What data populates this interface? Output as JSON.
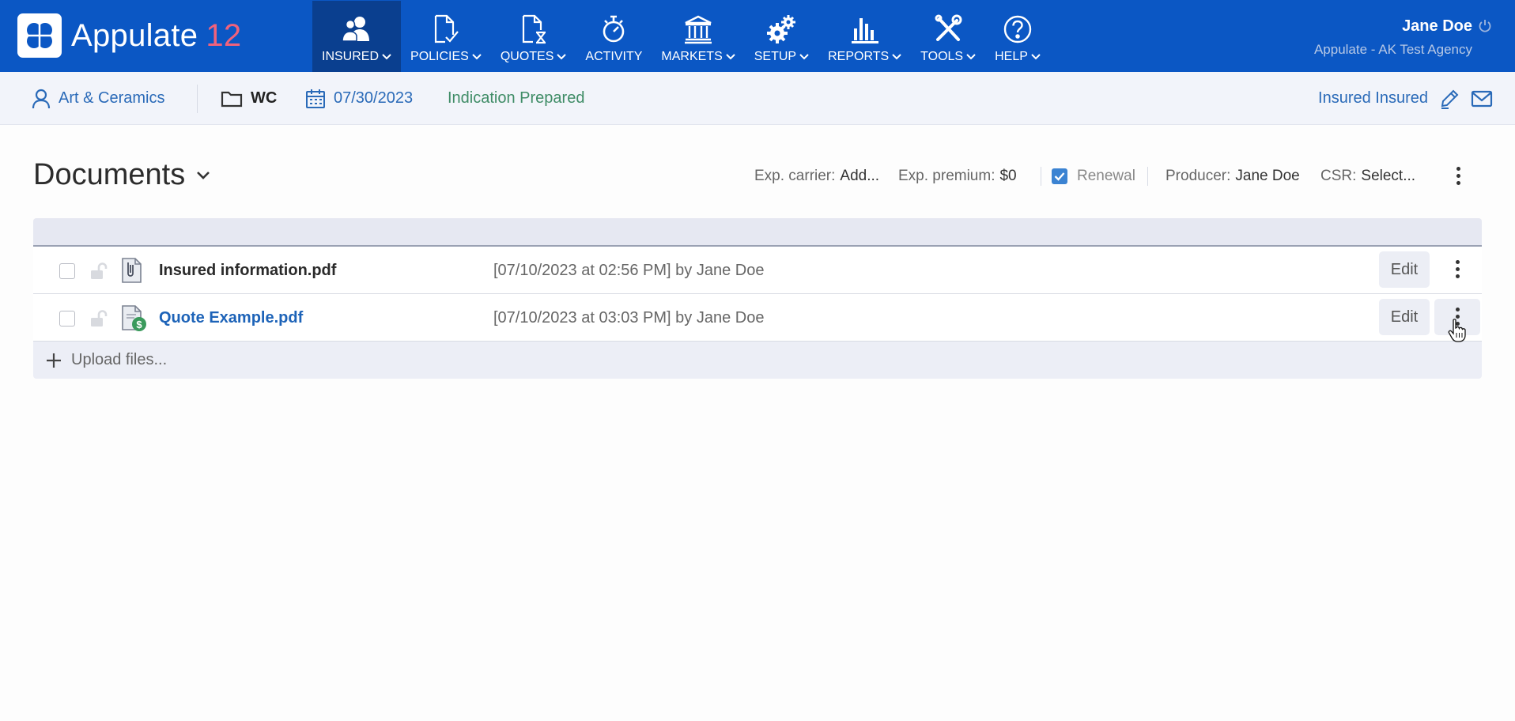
{
  "app": {
    "name": "Appulate",
    "version": "12"
  },
  "nav": [
    {
      "label": "INSURED",
      "icon": "users-icon",
      "active": true,
      "dropdown": true
    },
    {
      "label": "POLICIES",
      "icon": "policy-document-icon",
      "active": false,
      "dropdown": true
    },
    {
      "label": "QUOTES",
      "icon": "quote-hourglass-icon",
      "active": false,
      "dropdown": true
    },
    {
      "label": "ACTIVITY",
      "icon": "stopwatch-icon",
      "active": false,
      "dropdown": false
    },
    {
      "label": "MARKETS",
      "icon": "bank-icon",
      "active": false,
      "dropdown": true
    },
    {
      "label": "SETUP",
      "icon": "gears-icon",
      "active": false,
      "dropdown": true
    },
    {
      "label": "REPORTS",
      "icon": "bar-chart-icon",
      "active": false,
      "dropdown": true
    },
    {
      "label": "TOOLS",
      "icon": "tools-icon",
      "active": false,
      "dropdown": true
    },
    {
      "label": "HELP",
      "icon": "help-circle-icon",
      "active": false,
      "dropdown": true
    }
  ],
  "user": {
    "name": "Jane Doe",
    "agency": "Appulate - AK Test Agency"
  },
  "context": {
    "insured": "Art & Ceramics",
    "lob": "WC",
    "date": "07/30/2023",
    "status": "Indication Prepared",
    "contact": "Insured Insured"
  },
  "documents": {
    "title": "Documents",
    "exp_carrier_label": "Exp. carrier:",
    "exp_carrier_value": "Add...",
    "exp_premium_label": "Exp. premium:",
    "exp_premium_value": "$0",
    "renewal_label": "Renewal",
    "renewal_checked": true,
    "producer_label": "Producer:",
    "producer_value": "Jane Doe",
    "csr_label": "CSR:",
    "csr_value": "Select...",
    "rows": [
      {
        "name": "Insured information.pdf",
        "date": "[07/10/2023 at 02:56 PM] by Jane Doe",
        "edit": "Edit",
        "icon": "pdf-document-icon"
      },
      {
        "name": "Quote Example.pdf",
        "date": "[07/10/2023 at 03:03 PM] by Jane Doe",
        "edit": "Edit",
        "icon": "quote-document-icon"
      }
    ],
    "upload_label": "Upload files..."
  },
  "colors": {
    "topbar": "#0b57c4",
    "topbar_active": "#0a3f8f",
    "accent_link": "#1d63b8",
    "status_green": "#3f8c66",
    "logo_version": "#f0627c"
  }
}
